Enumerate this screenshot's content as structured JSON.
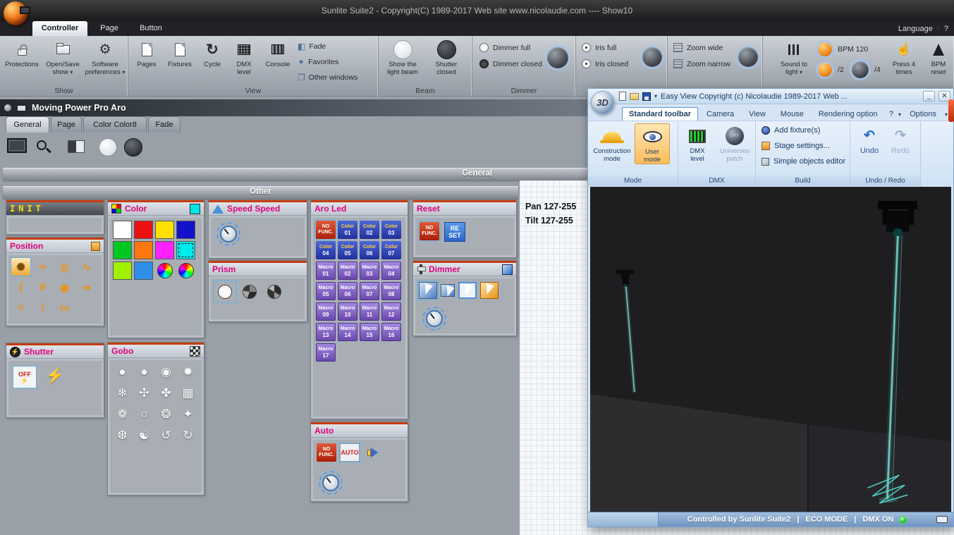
{
  "icons": {
    "caret": "▾",
    "help": "?",
    "close": "✕",
    "minimize": "_",
    "cycle": "↻",
    "undo": "↶",
    "redo": "↷",
    "lightning": "⚡",
    "pointer": "☝",
    "gear": "⚙",
    "fade": "◧",
    "favorites": "✦",
    "other_windows": "❐"
  },
  "titlebar": {
    "title": "Sunlite Suite2 - Copyright(C) 1989-2017    Web site www.nicolaudie.com ---- Show10",
    "language": "Language"
  },
  "tabs": [
    "Controller",
    "Page",
    "Button"
  ],
  "ribbon": {
    "show": {
      "label": "Show",
      "protections": "Protections",
      "opensave_l1": "Open/Save",
      "opensave_l2": "show",
      "prefs_l1": "Software",
      "prefs_l2": "preferences"
    },
    "view": {
      "label": "View",
      "items": [
        {
          "l1": "Pages",
          "l2": ""
        },
        {
          "l1": "Fixtures",
          "l2": ""
        },
        {
          "l1": "Cycle",
          "l2": ""
        },
        {
          "l1": "DMX",
          "l2": "level"
        },
        {
          "l1": "Console",
          "l2": ""
        }
      ],
      "side": [
        "Fade",
        "Favorites",
        "Other windows"
      ]
    },
    "beam": {
      "label": "Beam",
      "open_l1": "Show the",
      "open_l2": "light beam",
      "closed_l1": "Shutter",
      "closed_l2": "closed"
    },
    "dimmer": {
      "label": "Dimmer",
      "full": "Dimmer full",
      "closed": "Dimmer closed"
    },
    "iris": {
      "full": "Iris full",
      "closed": "Iris closed"
    },
    "zoom": {
      "wide": "Zoom wide",
      "narrow": "Zoom narrow"
    },
    "sound": {
      "stl_l1": "Sound to",
      "stl_l2": "light",
      "bpm": "BPM 120",
      "div2": "/2",
      "div4": "/4",
      "press_l1": "Press 4",
      "press_l2": "times",
      "reset_l1": "BPM",
      "reset_l2": "reset"
    }
  },
  "window": {
    "title": "Moving Power Pro Aro",
    "tabs": [
      "General",
      "Page",
      "Color Color8",
      "Fade"
    ],
    "general_bar": "General",
    "other_bar": "Other"
  },
  "panels": {
    "init": {
      "title": "INIT"
    },
    "position": {
      "title": "Position",
      "icons": [
        {
          "g": "✺",
          "cls": "sel"
        },
        {
          "g": "∞"
        },
        {
          "g": "◎"
        },
        {
          "g": "∿"
        },
        {
          "g": "ʃ"
        },
        {
          "g": "8"
        },
        {
          "g": "◉"
        },
        {
          "g": "➔"
        },
        {
          "g": "≡"
        },
        {
          "g": "I"
        },
        {
          "g": "ω"
        }
      ]
    },
    "shutter": {
      "title": "Shutter",
      "off": "OFF"
    },
    "color": {
      "title": "Color",
      "swatches": [
        "#ffffff",
        "#ee1111",
        "#ffe000",
        "#1212cc",
        "#00c822",
        "#ff7711",
        "#ff22ff",
        "#00eaea",
        "#a0f000",
        "#2e8fe8"
      ]
    },
    "gobo": {
      "title": "Gobo",
      "icons": [
        {
          "g": "●"
        },
        {
          "g": "●"
        },
        {
          "g": "◉"
        },
        {
          "g": "✹"
        },
        {
          "g": "❄"
        },
        {
          "g": "✣"
        },
        {
          "g": "✤"
        },
        {
          "g": "▦"
        },
        {
          "g": "❁"
        },
        {
          "g": "○"
        },
        {
          "g": "❂"
        },
        {
          "g": "✦"
        },
        {
          "g": "❆"
        },
        {
          "g": "☯"
        },
        {
          "g": "↺"
        },
        {
          "g": "↻"
        }
      ]
    },
    "speed": {
      "title": "Speed Speed"
    },
    "prism": {
      "title": "Prism"
    },
    "aro_led": {
      "title": "Aro Led",
      "no_func": {
        "l1": "NO",
        "l2": "FUNC."
      },
      "colors": [
        {
          "t": "Color",
          "n": "01"
        },
        {
          "t": "Color",
          "n": "02"
        },
        {
          "t": "Color",
          "n": "03"
        },
        {
          "t": "Color",
          "n": "04"
        },
        {
          "t": "Color",
          "n": "05"
        },
        {
          "t": "Color",
          "n": "06"
        },
        {
          "t": "Color",
          "n": "07"
        }
      ],
      "macros": [
        {
          "t": "Macro",
          "n": "01"
        },
        {
          "t": "Macro",
          "n": "02"
        },
        {
          "t": "Macro",
          "n": "03"
        },
        {
          "t": "Macro",
          "n": "04"
        },
        {
          "t": "Macro",
          "n": "05"
        },
        {
          "t": "Macro",
          "n": "06"
        },
        {
          "t": "Macro",
          "n": "07"
        },
        {
          "t": "Macro",
          "n": "08"
        },
        {
          "t": "Macro",
          "n": "09"
        },
        {
          "t": "Macro",
          "n": "10"
        },
        {
          "t": "Macro",
          "n": "11"
        },
        {
          "t": "Macro",
          "n": "12"
        },
        {
          "t": "Macro",
          "n": "13"
        },
        {
          "t": "Macro",
          "n": "14"
        },
        {
          "t": "Macro",
          "n": "15"
        },
        {
          "t": "Macro",
          "n": "16"
        },
        {
          "t": "Macro",
          "n": "17"
        }
      ]
    },
    "auto": {
      "title": "Auto",
      "auto": "AUTO"
    },
    "reset": {
      "title": "Reset",
      "reset_l1": "RE",
      "reset_l2": "SET"
    },
    "dimmer": {
      "title": "Dimmer"
    }
  },
  "easyview": {
    "title": "Easy View  Copyright (c) Nicolaudie 1989-2017  Web ...",
    "logo": "3D",
    "tabs": [
      "Standard toolbar",
      "Camera",
      "View",
      "Mouse",
      "Rendering option"
    ],
    "options": "Options",
    "mode": {
      "label": "Mode",
      "c_l1": "Construction",
      "c_l2": "mode",
      "u_l1": "User",
      "u_l2": "mode"
    },
    "dmx": {
      "label": "DMX",
      "lvl_l1": "DMX",
      "lvl_l2": "level",
      "patch_l1": "Universes",
      "patch_l2": "patch",
      "sphere": "DMX"
    },
    "build": {
      "label": "Build",
      "items": [
        "Add fixture(s)",
        "Stage settings...",
        "Simple objects editor"
      ]
    },
    "undoredo": {
      "label": "Undo / Redo",
      "undo": "Undo",
      "redo": "Redo"
    },
    "status": {
      "controlled": "Controlled by Sunlite Suite2",
      "sep": "|",
      "eco": "ECO MODE",
      "dmx": "DMX ON"
    }
  },
  "grid": {
    "pan": "Pan 127-255",
    "tilt": "Tilt 127-255"
  }
}
